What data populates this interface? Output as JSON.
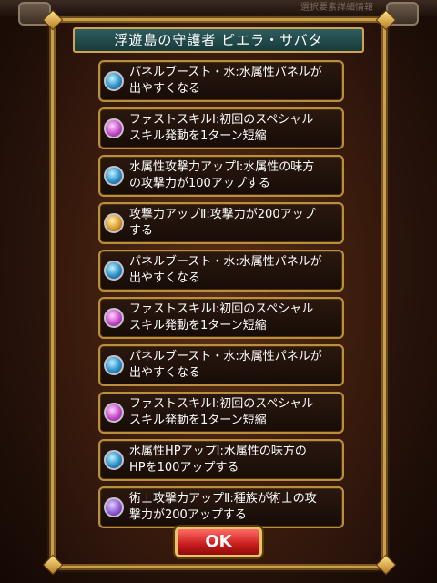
{
  "top_strip": {
    "text": "選択要素詳細情報"
  },
  "dialog": {
    "title": "浮遊島の守護者 ピエラ・サバタ",
    "ok_label": "OK"
  },
  "skills": [
    {
      "icon": "water-panel-icon",
      "icon_color": "blue",
      "text": "パネルブースト・水:水属性パネルが\n出やすくなる"
    },
    {
      "icon": "fast-skill-icon",
      "icon_color": "pink",
      "text": "ファストスキルⅠ:初回のスペシャル\nスキル発動を1ターン短縮"
    },
    {
      "icon": "water-attack-icon",
      "icon_color": "blue",
      "text": "水属性攻撃力アップⅠ:水属性の味方\nの攻撃力が100アップする"
    },
    {
      "icon": "attack-up-icon",
      "icon_color": "gold",
      "text": "攻撃力アップⅡ:攻撃力が200アップ\nする"
    },
    {
      "icon": "water-panel-icon",
      "icon_color": "blue",
      "text": "パネルブースト・水:水属性パネルが\n出やすくなる"
    },
    {
      "icon": "fast-skill-icon",
      "icon_color": "pink",
      "text": "ファストスキルⅠ:初回のスペシャル\nスキル発動を1ターン短縮"
    },
    {
      "icon": "water-panel-icon",
      "icon_color": "blue",
      "text": "パネルブースト・水:水属性パネルが\n出やすくなる"
    },
    {
      "icon": "fast-skill-icon",
      "icon_color": "pink",
      "text": "ファストスキルⅠ:初回のスペシャル\nスキル発動を1ターン短縮"
    },
    {
      "icon": "water-hp-icon",
      "icon_color": "blue",
      "text": "水属性HPアップⅠ:水属性の味方の\nHPを100アップする"
    },
    {
      "icon": "mage-attack-icon",
      "icon_color": "purple",
      "text": "術士攻撃力アップⅡ:種族が術士の攻\n撃力が200アップする"
    }
  ]
}
